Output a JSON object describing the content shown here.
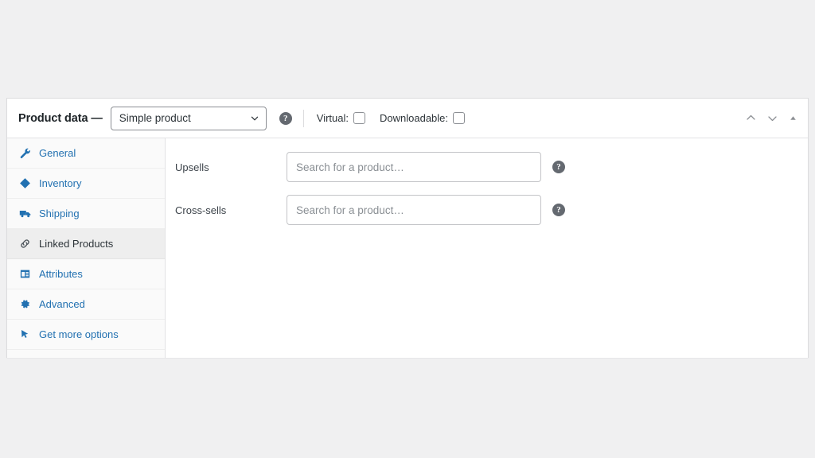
{
  "panel": {
    "title": "Product data —",
    "product_type": {
      "selected": "Simple product",
      "icon": "chevron-down-icon"
    },
    "header_help_icon": "help-icon",
    "header_help_glyph": "?",
    "checkboxes": [
      {
        "label": "Virtual:",
        "checked": false,
        "name": "virtual"
      },
      {
        "label": "Downloadable:",
        "checked": false,
        "name": "downloadable"
      }
    ],
    "actions": [
      {
        "name": "move-up-icon",
        "title": "Move up"
      },
      {
        "name": "move-down-icon",
        "title": "Move down"
      },
      {
        "name": "toggle-panel-icon",
        "title": "Toggle panel"
      }
    ]
  },
  "tabs": [
    {
      "label": "General",
      "icon": "wrench-icon",
      "active": false
    },
    {
      "label": "Inventory",
      "icon": "box-icon",
      "active": false
    },
    {
      "label": "Shipping",
      "icon": "truck-icon",
      "active": false
    },
    {
      "label": "Linked Products",
      "icon": "link-icon",
      "active": true
    },
    {
      "label": "Attributes",
      "icon": "table-icon",
      "active": false
    },
    {
      "label": "Advanced",
      "icon": "gear-icon",
      "active": false
    },
    {
      "label": "Get more options",
      "icon": "cursor-icon",
      "active": false
    }
  ],
  "fields": [
    {
      "label": "Upsells",
      "value": "",
      "placeholder": "Search for a product…",
      "help_glyph": "?",
      "name": "upsells"
    },
    {
      "label": "Cross-sells",
      "value": "",
      "placeholder": "Search for a product…",
      "help_glyph": "?",
      "name": "cross-sells"
    }
  ],
  "colors": {
    "page_background": "#f0f0f1",
    "panel_background": "#ffffff",
    "accent_link": "#2271b1",
    "active_tab_background": "#eeeeee",
    "border": "#dcdcde",
    "help_icon": "#646970"
  }
}
